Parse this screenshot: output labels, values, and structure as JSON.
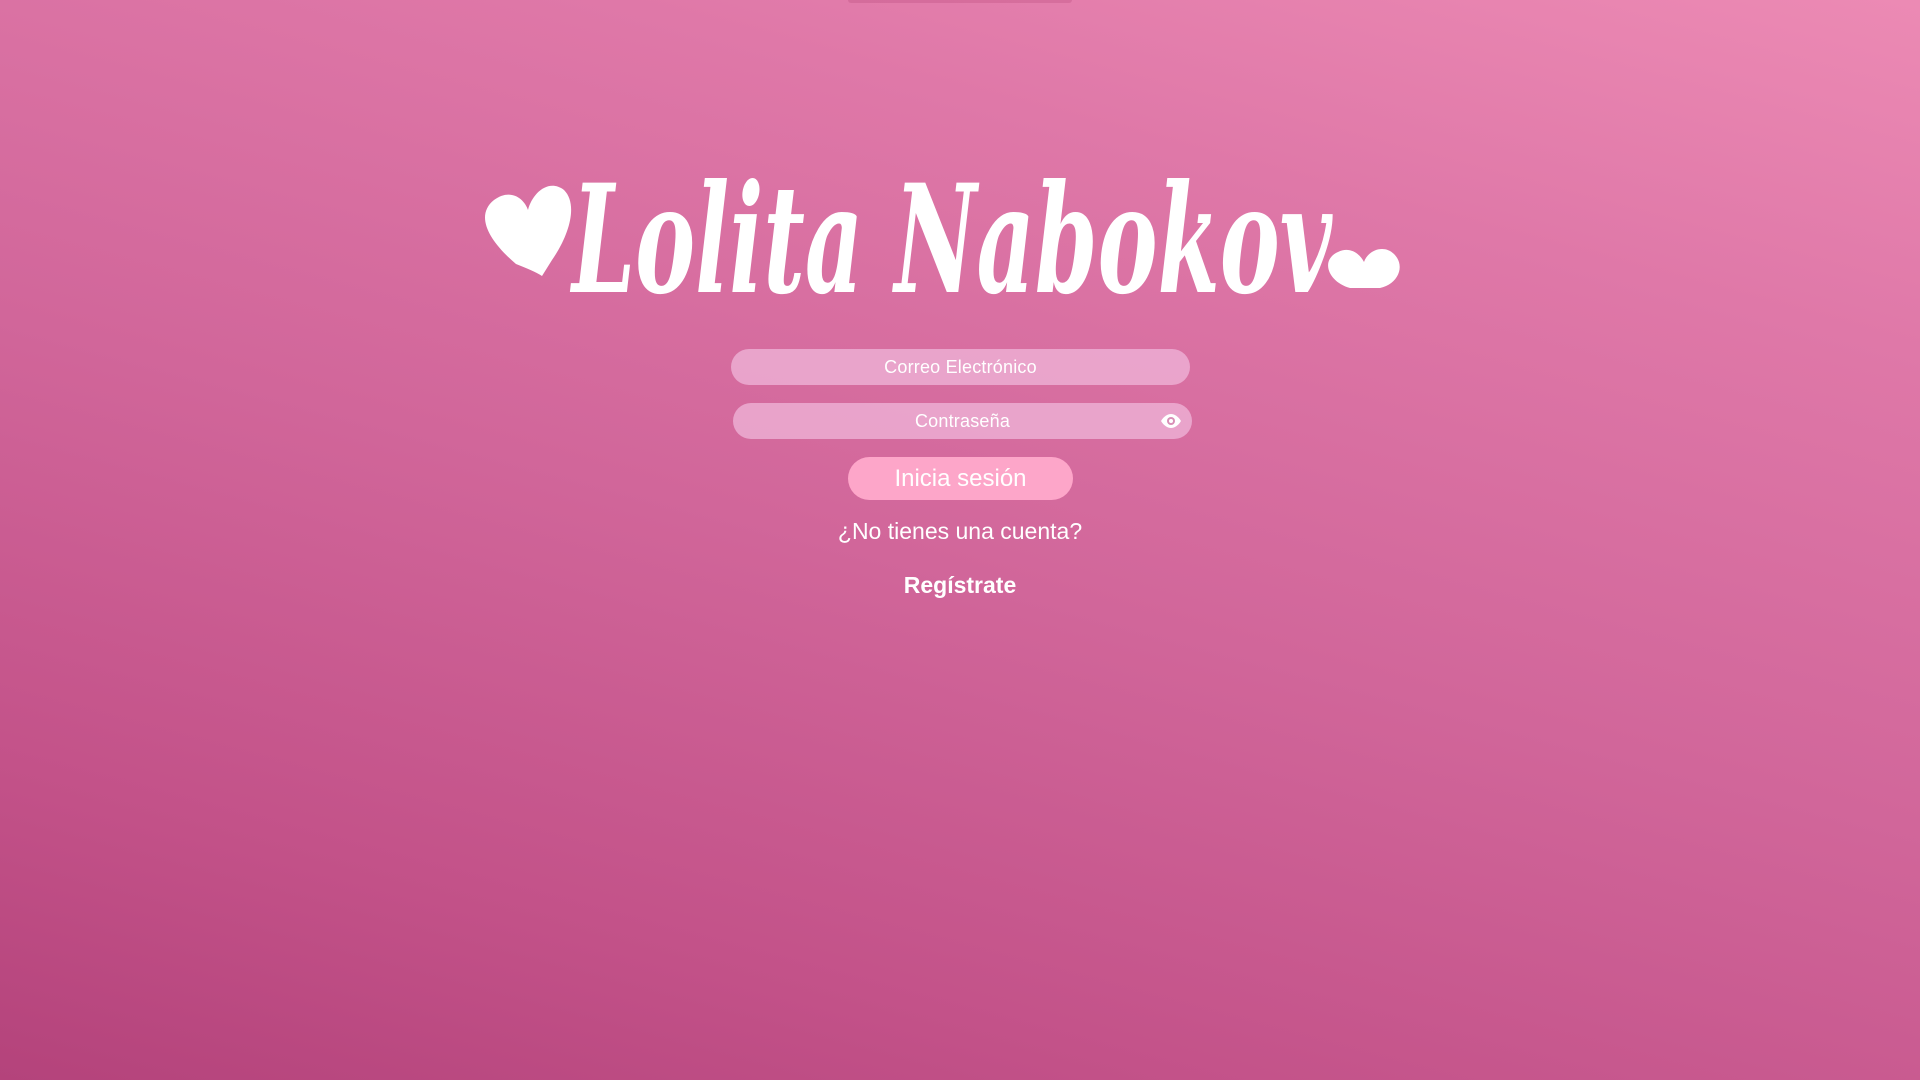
{
  "brand": {
    "logo_text": "Lolita Nabokov",
    "color": "#ffffff"
  },
  "login_form": {
    "email_placeholder": "Correo Electrónico",
    "password_placeholder": "Contraseña",
    "password_toggle_icon": "eye-icon",
    "submit_label": "Inicia sesión",
    "no_account_text": "¿No tienes una cuenta?",
    "register_label": "Regístrate"
  },
  "colors": {
    "background_light": "#ec8ab4",
    "background_dark": "#b4437b",
    "field_fill": "#eeb4d7",
    "button_fill": "#fda6c9",
    "text": "#ffffff"
  }
}
